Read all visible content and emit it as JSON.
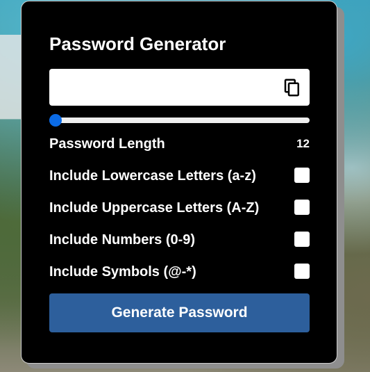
{
  "app": {
    "title": "Password Generator"
  },
  "password": {
    "value": "",
    "copy_icon": "copy-icon"
  },
  "length": {
    "label": "Password Length",
    "value": "12",
    "slider_fraction": 0.0
  },
  "options": [
    {
      "label": "Include Lowercase Letters (a-z)",
      "checked": false
    },
    {
      "label": "Include Uppercase Letters (A-Z)",
      "checked": false
    },
    {
      "label": "Include Numbers (0-9)",
      "checked": false
    },
    {
      "label": "Include Symbols (@-*)",
      "checked": false
    }
  ],
  "button": {
    "label": "Generate Password"
  },
  "colors": {
    "accent": "#0b6be6",
    "button": "#2d5f9c",
    "card": "#000000"
  }
}
